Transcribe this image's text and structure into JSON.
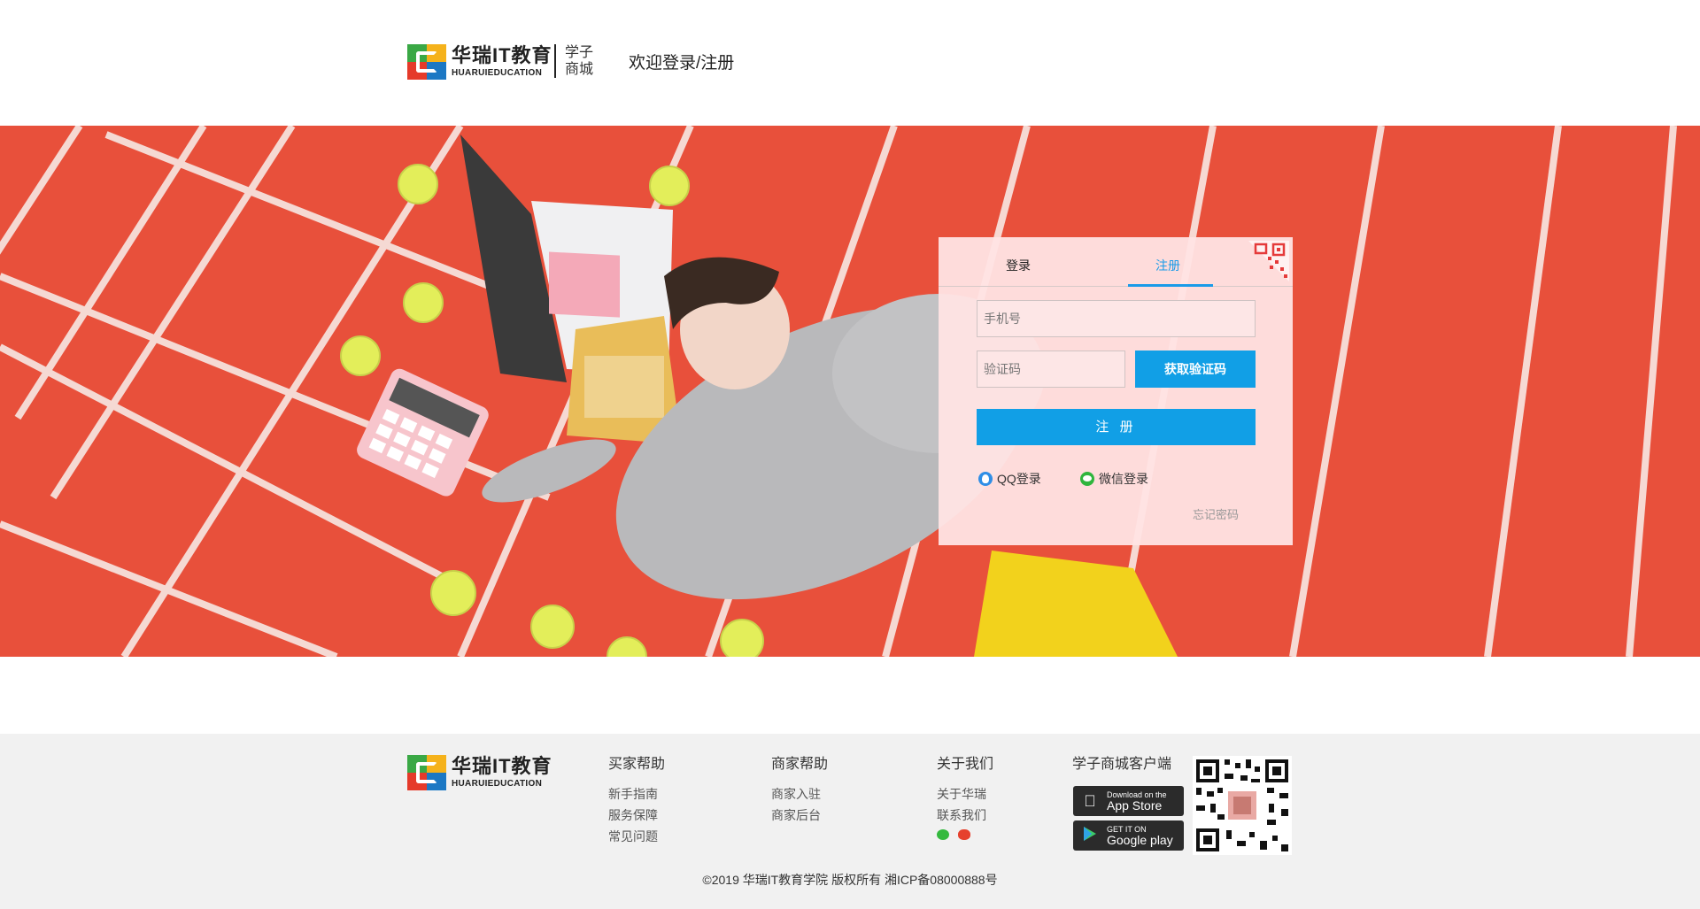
{
  "header": {
    "logo_cn": "华瑞IT教育",
    "logo_en": "HUARUIEDUCATION",
    "sub_line1": "学子",
    "sub_line2": "商城",
    "welcome": "欢迎登录/注册"
  },
  "login": {
    "tabs": [
      {
        "label": "登录",
        "active": false
      },
      {
        "label": "注册",
        "active": true
      }
    ],
    "phone_placeholder": "手机号",
    "code_placeholder": "验证码",
    "get_code_label": "获取验证码",
    "register_label": "注 册",
    "qq_login": "QQ登录",
    "wechat_login": "微信登录",
    "forgot": "忘记密码",
    "accent_color": "#119fe6"
  },
  "footer": {
    "logo_cn": "华瑞IT教育",
    "logo_en": "HUARUIEDUCATION",
    "columns": [
      {
        "title": "买家帮助",
        "links": [
          "新手指南",
          "服务保障",
          "常见问题"
        ]
      },
      {
        "title": "商家帮助",
        "links": [
          "商家入驻",
          "商家后台"
        ]
      },
      {
        "title": "关于我们",
        "links": [
          "关于华瑞",
          "联系我们"
        ],
        "icons": [
          "wechat-icon",
          "weibo-icon"
        ]
      },
      {
        "title": "学子商城客户端"
      }
    ],
    "app_store": {
      "small": "Download on the",
      "big": "App Store"
    },
    "google_play": {
      "small": "GET IT ON",
      "big": "Google play"
    },
    "copyright": "©2019 华瑞IT教育学院 版权所有 湘ICP备08000888号"
  }
}
